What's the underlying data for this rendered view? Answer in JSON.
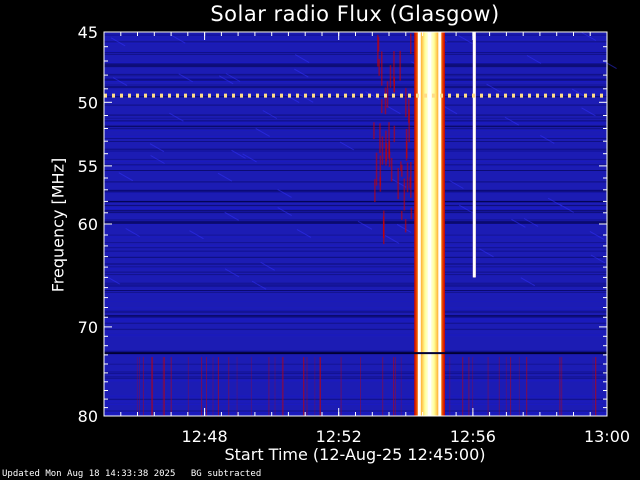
{
  "chart_data": {
    "type": "heatmap",
    "title": "Solar radio Flux (Glasgow)",
    "xlabel": "Start Time (12-Aug-25 12:45:00)",
    "ylabel": "Frequency [MHz]",
    "x_unit": "time (HH:MM)",
    "xlim": [
      "12:45",
      "13:00"
    ],
    "ylim": [
      45,
      80
    ],
    "y_scale": "log",
    "x_ticks": [
      "12:48",
      "12:52",
      "12:56",
      "13:00"
    ],
    "y_ticks": [
      45,
      50,
      55,
      60,
      70,
      80
    ],
    "colormap": [
      "#000040",
      "#1a1acc",
      "#3333ff",
      "#cc0000",
      "#ff8800",
      "#ffff99",
      "#ffffff"
    ],
    "background_color": "#1c1cb4",
    "events": [
      {
        "label": "burst",
        "time_start": "12:54:15",
        "time_end": "12:55:10",
        "freq_range": [
          45,
          80
        ],
        "intensity": "high"
      },
      {
        "label": "burst",
        "time_start": "12:56:00",
        "time_end": "12:56:05",
        "freq_range": [
          45,
          65
        ],
        "intensity": "high"
      },
      {
        "label": "interference",
        "freq": 49.5,
        "time_range": [
          "12:45",
          "13:00"
        ]
      },
      {
        "label": "interference",
        "freq": 72.8,
        "time_range": [
          "12:45",
          "13:00"
        ]
      }
    ]
  },
  "footer": {
    "updated": "Updated Mon Aug 18 14:33:38 2025",
    "bg_note": "BG subtracted"
  }
}
